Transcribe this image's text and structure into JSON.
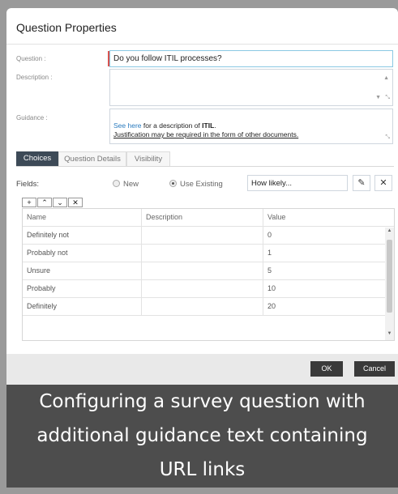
{
  "dialog": {
    "title": "Question Properties"
  },
  "fields": {
    "question_label": "Question :",
    "question_value": "Do you follow ITIL processes?",
    "description_label": "Description :",
    "guidance_label": "Guidance :",
    "guidance": {
      "link_text": "See here",
      "line1_rest": " for a description of ",
      "line1_bold": "ITIL",
      "line1_end": ".",
      "line2": "Justification may be required in the form of other documents."
    }
  },
  "tabs": [
    {
      "label": "Choices",
      "active": true
    },
    {
      "label": "Question Details",
      "active": false
    },
    {
      "label": "Visibility",
      "active": false
    }
  ],
  "choices": {
    "fields_label": "Fields:",
    "radio_new": "New",
    "radio_existing": "Use Existing",
    "selected_existing": true,
    "select_value": "How likely...",
    "columns": [
      "Name",
      "Description",
      "Value"
    ],
    "rows": [
      {
        "name": "Definitely not",
        "description": "",
        "value": "0"
      },
      {
        "name": "Probably not",
        "description": "",
        "value": "1"
      },
      {
        "name": "Unsure",
        "description": "",
        "value": "5"
      },
      {
        "name": "Probably",
        "description": "",
        "value": "10"
      },
      {
        "name": "Definitely",
        "description": "",
        "value": "20"
      }
    ]
  },
  "buttons": {
    "ok": "OK",
    "cancel": "Cancel"
  },
  "caption": {
    "line1": "Configuring a survey question with",
    "line2": "additional guidance text containing",
    "line3": "URL links"
  },
  "icons": {
    "edit": "pencil-icon",
    "close": "close-icon",
    "add": "plus-icon",
    "up": "chevron-up-icon",
    "down": "chevron-down-icon",
    "remove": "close-icon"
  }
}
